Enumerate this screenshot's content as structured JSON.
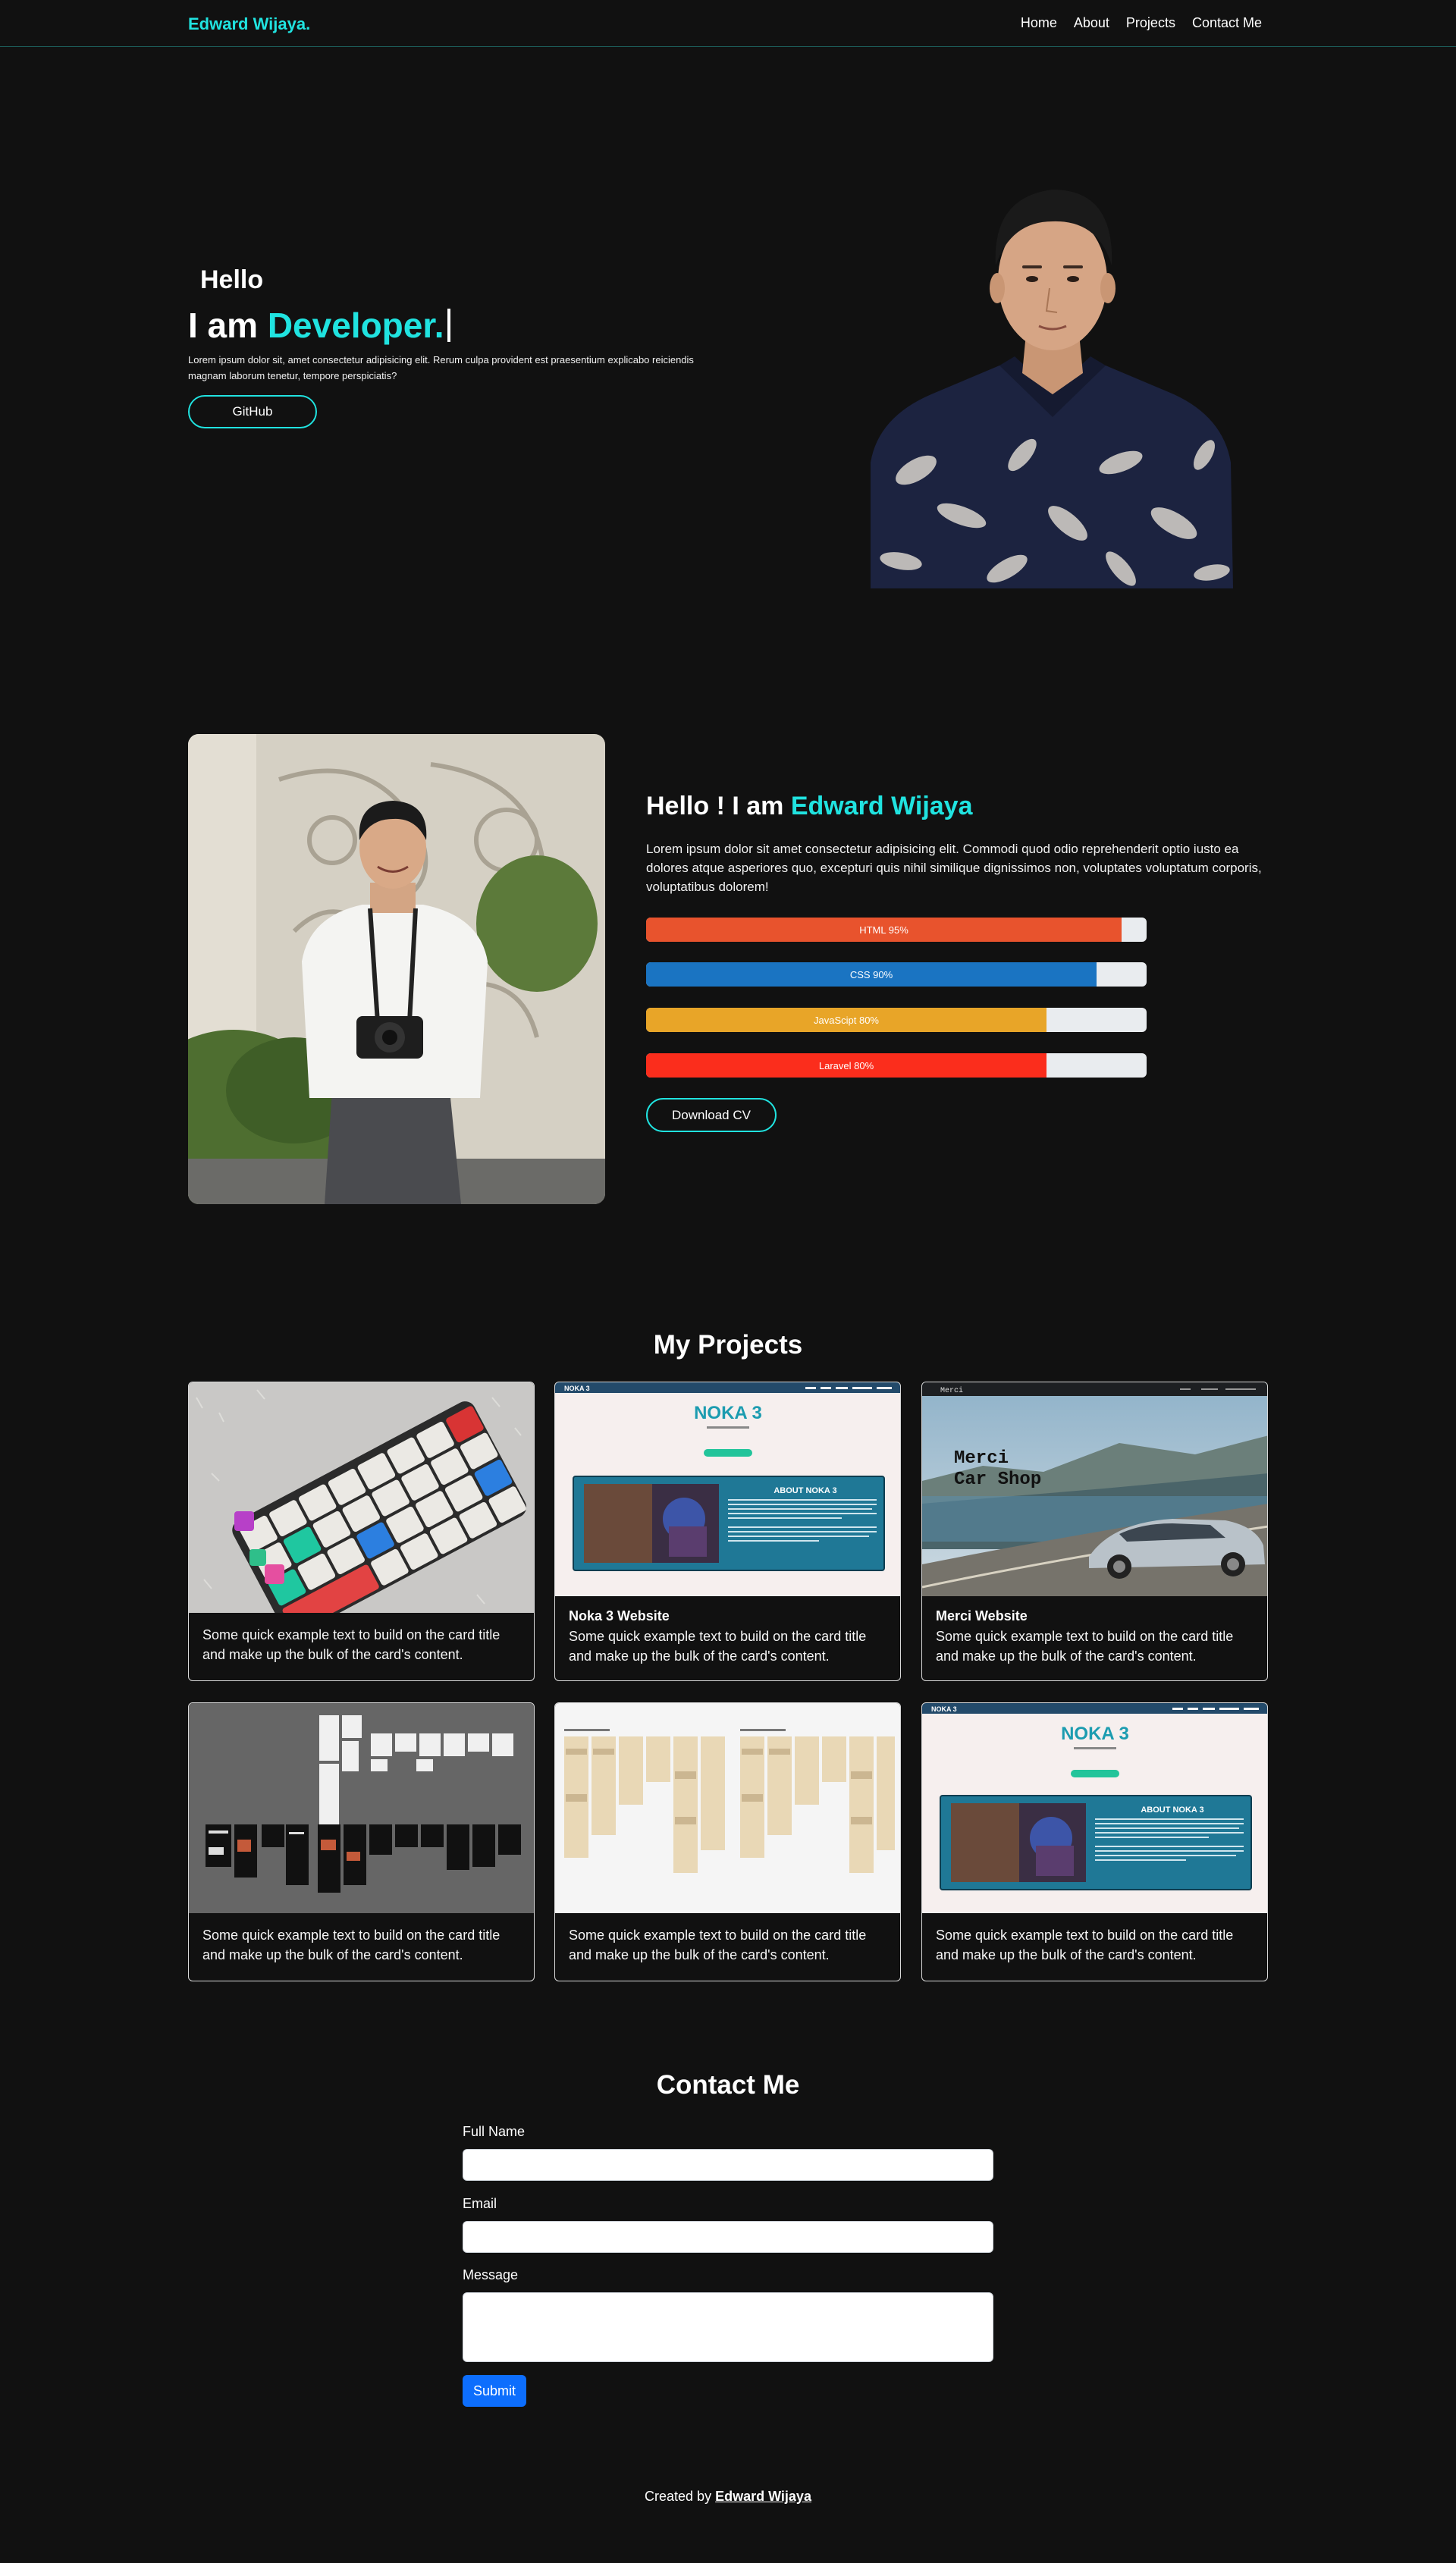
{
  "nav": {
    "brand": "Edward Wijaya.",
    "links": [
      "Home",
      "About",
      "Projects",
      "Contact Me"
    ]
  },
  "hero": {
    "hello": "Hello",
    "title_prefix": "I am ",
    "title_accent": "Developer.",
    "description": "Lorem ipsum dolor sit, amet consectetur adipisicing elit. Rerum culpa provident est praesentium explicabo reiciendis magnam laborum tenetur, tempore perspiciatis?",
    "github_label": "GitHub"
  },
  "about": {
    "title_prefix": "Hello ! I am ",
    "title_accent": "Edward Wijaya",
    "description": "Lorem ipsum dolor sit amet consectetur adipisicing elit. Commodi quod odio reprehenderit optio iusto ea dolores atque asperiores quo, excepturi quis nihil similique dignissimos non, voluptates voluptatum corporis, voluptatibus dolorem!",
    "skills": [
      {
        "label": "HTML 95%",
        "percent": 95,
        "color": "#e8532d"
      },
      {
        "label": "CSS 90%",
        "percent": 90,
        "color": "#1a74c2"
      },
      {
        "label": "JavaScipt 80%",
        "percent": 80,
        "color": "#e8a528"
      },
      {
        "label": "Laravel 80%",
        "percent": 80,
        "color": "#fb2d1c"
      }
    ],
    "download_label": "Download CV"
  },
  "projects": {
    "title": "My Projects",
    "cards": [
      {
        "title": "",
        "text": "Some quick example text to build on the card title and make up the bulk of the card's content.",
        "image": "keyboard"
      },
      {
        "title": "Noka 3 Website",
        "text": "Some quick example text to build on the card title and make up the bulk of the card's content.",
        "image": "noka",
        "thumb": {
          "brand": "NOKA 3",
          "heading": "NOKA 3",
          "about": "ABOUT NOKA 3"
        }
      },
      {
        "title": "Merci Website",
        "text": "Some quick example text to build on the card title and make up the bulk of the card's content.",
        "image": "merci",
        "thumb": {
          "brand": "Merci",
          "heading": "Merci\nCar Shop"
        }
      },
      {
        "title": "",
        "text": "Some quick example text to build on the card title and make up the bulk of the card's content.",
        "image": "figma-dark"
      },
      {
        "title": "",
        "text": "Some quick example text to build on the card title and make up the bulk of the card's content.",
        "image": "figma-light"
      },
      {
        "title": "",
        "text": "Some quick example text to build on the card title and make up the bulk of the card's content.",
        "image": "noka",
        "thumb": {
          "brand": "NOKA 3",
          "heading": "NOKA 3",
          "about": "ABOUT NOKA 3"
        }
      }
    ]
  },
  "contact": {
    "title": "Contact Me",
    "full_name_label": "Full Name",
    "email_label": "Email",
    "message_label": "Message",
    "submit_label": "Submit"
  },
  "footer": {
    "prefix": "Created by ",
    "name": "Edward Wijaya"
  },
  "colors": {
    "accent": "#20e3e0",
    "background": "#111111",
    "submit": "#0d6efd"
  }
}
